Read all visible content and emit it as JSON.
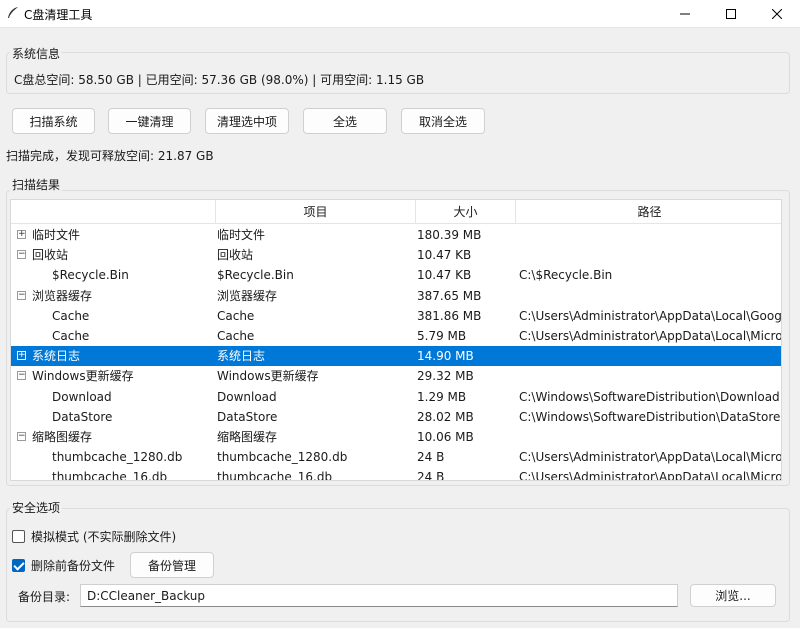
{
  "window": {
    "title": "C盘清理工具"
  },
  "system_info": {
    "group_title": "系统信息",
    "summary": "C盘总空间: 58.50 GB | 已用空间: 57.36 GB (98.0%) | 可用空间: 1.15 GB"
  },
  "toolbar": {
    "scan": "扫描系统",
    "clean_all": "一键清理",
    "clean_selected": "清理选中项",
    "select_all": "全选",
    "deselect_all": "取消全选"
  },
  "status_text": "扫描完成，发现可释放空间: 21.87 GB",
  "results": {
    "group_title": "扫描结果",
    "columns": [
      "",
      "项目",
      "大小",
      "路径"
    ],
    "rows": [
      {
        "name": "临时文件",
        "item": "临时文件",
        "size": "180.39 MB",
        "path": "",
        "level": 0,
        "expander": "+",
        "selected": false
      },
      {
        "name": "回收站",
        "item": "回收站",
        "size": "10.47 KB",
        "path": "",
        "level": 0,
        "expander": "−",
        "selected": false
      },
      {
        "name": "$Recycle.Bin",
        "item": "$Recycle.Bin",
        "size": "10.47 KB",
        "path": "C:\\$Recycle.Bin",
        "level": 1,
        "expander": "",
        "selected": false
      },
      {
        "name": "浏览器缓存",
        "item": "浏览器缓存",
        "size": "387.65 MB",
        "path": "",
        "level": 0,
        "expander": "−",
        "selected": false
      },
      {
        "name": "Cache",
        "item": "Cache",
        "size": "381.86 MB",
        "path": "C:\\Users\\Administrator\\AppData\\Local\\Goog",
        "level": 1,
        "expander": "",
        "selected": false
      },
      {
        "name": "Cache",
        "item": "Cache",
        "size": "5.79 MB",
        "path": "C:\\Users\\Administrator\\AppData\\Local\\Micro",
        "level": 1,
        "expander": "",
        "selected": false
      },
      {
        "name": "系统日志",
        "item": "系统日志",
        "size": "14.90 MB",
        "path": "",
        "level": 0,
        "expander": "+",
        "selected": true
      },
      {
        "name": "Windows更新缓存",
        "item": "Windows更新缓存",
        "size": "29.32 MB",
        "path": "",
        "level": 0,
        "expander": "−",
        "selected": false
      },
      {
        "name": "Download",
        "item": "Download",
        "size": "1.29 MB",
        "path": "C:\\Windows\\SoftwareDistribution\\Download",
        "level": 1,
        "expander": "",
        "selected": false
      },
      {
        "name": "DataStore",
        "item": "DataStore",
        "size": "28.02 MB",
        "path": "C:\\Windows\\SoftwareDistribution\\DataStore",
        "level": 1,
        "expander": "",
        "selected": false
      },
      {
        "name": "缩略图缓存",
        "item": "缩略图缓存",
        "size": "10.06 MB",
        "path": "",
        "level": 0,
        "expander": "−",
        "selected": false
      },
      {
        "name": "thumbcache_1280.db",
        "item": "thumbcache_1280.db",
        "size": "24 B",
        "path": "C:\\Users\\Administrator\\AppData\\Local\\Micro",
        "level": 1,
        "expander": "",
        "selected": false
      },
      {
        "name": "thumbcache_16.db",
        "item": "thumbcache_16.db",
        "size": "24 B",
        "path": "C:\\Users\\Administrator\\AppData\\Local\\Micro",
        "level": 1,
        "expander": "",
        "selected": false
      }
    ]
  },
  "safety": {
    "group_title": "安全选项",
    "simulate_label": "模拟模式 (不实际删除文件)",
    "simulate_checked": false,
    "backup_label": "删除前备份文件",
    "backup_checked": true,
    "backup_manage": "备份管理",
    "dir_label": "备份目录:",
    "dir_value": "D:CCleaner_Backup",
    "browse": "浏览..."
  },
  "colors": {
    "selection": "#0078d7",
    "checkbox_on": "#0067c0"
  }
}
